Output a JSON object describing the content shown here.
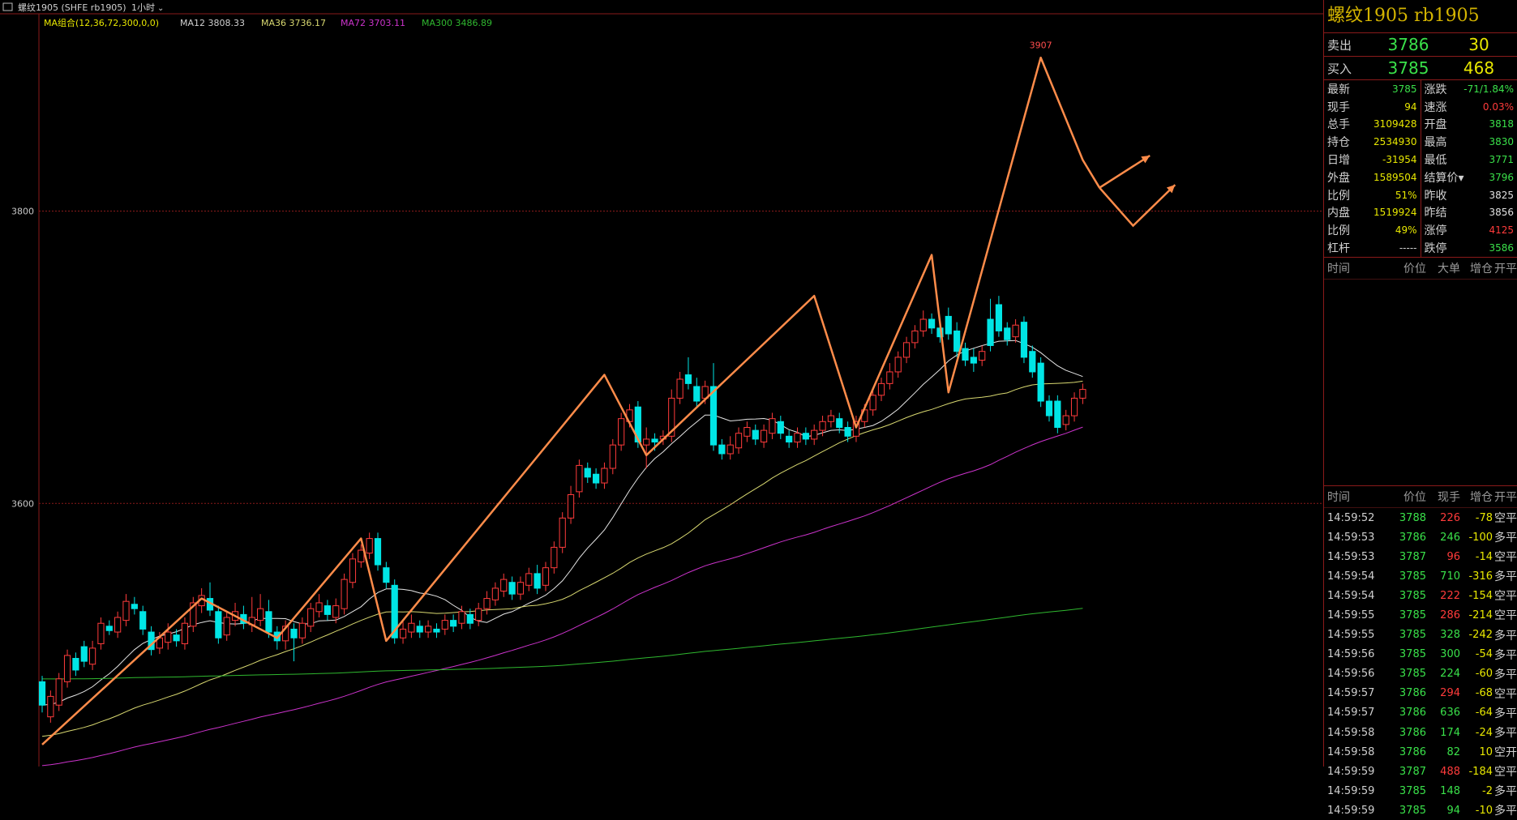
{
  "colors": {
    "up": "#ff3b3b",
    "down": "#00e5e5",
    "flat": "#d0d0d0",
    "green": "#3ae14a",
    "yellow": "#e8e800",
    "grid": "#8a1a1a",
    "ma12": "#e6e6e6",
    "ma36": "#d8d870",
    "ma72": "#cc33cc",
    "ma300": "#2fb82f",
    "pattern": "#ff8c4a"
  },
  "header": {
    "symbol": "螺纹1905 (SHFE rb1905)",
    "period": "1小时",
    "ma_group": "MA组合(12,36,72,300,0,0)",
    "ma12": "MA12 3808.33",
    "ma36": "MA36 3736.17",
    "ma72": "MA72 3703.11",
    "ma300": "MA300 3486.89"
  },
  "chart_data": {
    "type": "candlestick",
    "ylim": [
      3420,
      3935
    ],
    "yticks": [
      3600,
      3800
    ],
    "peak_label": "3907",
    "pattern_points": [
      [
        0,
        3435
      ],
      [
        19,
        3535
      ],
      [
        28,
        3508
      ],
      [
        38,
        3576
      ],
      [
        41,
        3506
      ],
      [
        67,
        3688
      ],
      [
        72,
        3633
      ],
      [
        92,
        3742
      ],
      [
        97,
        3652
      ],
      [
        106,
        3770
      ],
      [
        108,
        3676
      ],
      [
        119,
        3905
      ],
      [
        124,
        3835
      ],
      [
        126,
        3816
      ]
    ],
    "projection_arrows": [
      [
        [
          126,
          3816
        ],
        [
          132,
          3838
        ]
      ],
      [
        [
          126,
          3816
        ],
        [
          130,
          3790
        ],
        [
          135,
          3818
        ]
      ]
    ],
    "candles": [
      {
        "o": 3478,
        "c": 3462,
        "h": 3482,
        "l": 3457
      },
      {
        "o": 3454,
        "c": 3468,
        "h": 3472,
        "l": 3450
      },
      {
        "o": 3462,
        "c": 3480,
        "h": 3484,
        "l": 3458
      },
      {
        "o": 3478,
        "c": 3496,
        "h": 3500,
        "l": 3474
      },
      {
        "o": 3494,
        "c": 3486,
        "h": 3498,
        "l": 3482
      },
      {
        "o": 3502,
        "c": 3492,
        "h": 3506,
        "l": 3488
      },
      {
        "o": 3490,
        "c": 3501,
        "h": 3506,
        "l": 3486
      },
      {
        "o": 3504,
        "c": 3518,
        "h": 3522,
        "l": 3500
      },
      {
        "o": 3516,
        "c": 3513,
        "h": 3520,
        "l": 3510
      },
      {
        "o": 3512,
        "c": 3522,
        "h": 3526,
        "l": 3508
      },
      {
        "o": 3520,
        "c": 3533,
        "h": 3538,
        "l": 3516
      },
      {
        "o": 3531,
        "c": 3528,
        "h": 3536,
        "l": 3524
      },
      {
        "o": 3526,
        "c": 3514,
        "h": 3530,
        "l": 3510
      },
      {
        "o": 3512,
        "c": 3500,
        "h": 3516,
        "l": 3496
      },
      {
        "o": 3501,
        "c": 3508,
        "h": 3512,
        "l": 3497
      },
      {
        "o": 3505,
        "c": 3512,
        "h": 3518,
        "l": 3500
      },
      {
        "o": 3510,
        "c": 3506,
        "h": 3514,
        "l": 3502
      },
      {
        "o": 3504,
        "c": 3518,
        "h": 3522,
        "l": 3500
      },
      {
        "o": 3516,
        "c": 3532,
        "h": 3536,
        "l": 3512
      },
      {
        "o": 3530,
        "c": 3537,
        "h": 3542,
        "l": 3525
      },
      {
        "o": 3535,
        "c": 3527,
        "h": 3546,
        "l": 3523
      },
      {
        "o": 3526,
        "c": 3508,
        "h": 3530,
        "l": 3504
      },
      {
        "o": 3510,
        "c": 3522,
        "h": 3526,
        "l": 3506
      },
      {
        "o": 3520,
        "c": 3526,
        "h": 3532,
        "l": 3516
      },
      {
        "o": 3524,
        "c": 3518,
        "h": 3530,
        "l": 3514
      },
      {
        "o": 3517,
        "c": 3522,
        "h": 3536,
        "l": 3512
      },
      {
        "o": 3520,
        "c": 3528,
        "h": 3538,
        "l": 3516
      },
      {
        "o": 3526,
        "c": 3512,
        "h": 3534,
        "l": 3508
      },
      {
        "o": 3512,
        "c": 3506,
        "h": 3516,
        "l": 3500
      },
      {
        "o": 3506,
        "c": 3516,
        "h": 3520,
        "l": 3500
      },
      {
        "o": 3514,
        "c": 3508,
        "h": 3518,
        "l": 3492
      },
      {
        "o": 3508,
        "c": 3518,
        "h": 3522,
        "l": 3504
      },
      {
        "o": 3516,
        "c": 3528,
        "h": 3532,
        "l": 3512
      },
      {
        "o": 3526,
        "c": 3532,
        "h": 3538,
        "l": 3522
      },
      {
        "o": 3530,
        "c": 3524,
        "h": 3534,
        "l": 3520
      },
      {
        "o": 3522,
        "c": 3530,
        "h": 3535,
        "l": 3518
      },
      {
        "o": 3528,
        "c": 3548,
        "h": 3552,
        "l": 3524
      },
      {
        "o": 3546,
        "c": 3562,
        "h": 3566,
        "l": 3542
      },
      {
        "o": 3560,
        "c": 3568,
        "h": 3572,
        "l": 3556
      },
      {
        "o": 3566,
        "c": 3576,
        "h": 3580,
        "l": 3562
      },
      {
        "o": 3576,
        "c": 3558,
        "h": 3580,
        "l": 3554
      },
      {
        "o": 3556,
        "c": 3546,
        "h": 3560,
        "l": 3542
      },
      {
        "o": 3544,
        "c": 3508,
        "h": 3548,
        "l": 3504
      },
      {
        "o": 3508,
        "c": 3514,
        "h": 3520,
        "l": 3504
      },
      {
        "o": 3512,
        "c": 3518,
        "h": 3524,
        "l": 3508
      },
      {
        "o": 3516,
        "c": 3512,
        "h": 3520,
        "l": 3508
      },
      {
        "o": 3512,
        "c": 3516,
        "h": 3520,
        "l": 3508
      },
      {
        "o": 3514,
        "c": 3512,
        "h": 3518,
        "l": 3508
      },
      {
        "o": 3514,
        "c": 3520,
        "h": 3524,
        "l": 3510
      },
      {
        "o": 3520,
        "c": 3516,
        "h": 3524,
        "l": 3512
      },
      {
        "o": 3518,
        "c": 3526,
        "h": 3530,
        "l": 3514
      },
      {
        "o": 3524,
        "c": 3518,
        "h": 3528,
        "l": 3514
      },
      {
        "o": 3520,
        "c": 3528,
        "h": 3532,
        "l": 3516
      },
      {
        "o": 3528,
        "c": 3535,
        "h": 3540,
        "l": 3524
      },
      {
        "o": 3534,
        "c": 3542,
        "h": 3546,
        "l": 3530
      },
      {
        "o": 3540,
        "c": 3548,
        "h": 3552,
        "l": 3536
      },
      {
        "o": 3546,
        "c": 3538,
        "h": 3550,
        "l": 3534
      },
      {
        "o": 3538,
        "c": 3546,
        "h": 3550,
        "l": 3534
      },
      {
        "o": 3544,
        "c": 3552,
        "h": 3556,
        "l": 3540
      },
      {
        "o": 3552,
        "c": 3542,
        "h": 3558,
        "l": 3538
      },
      {
        "o": 3544,
        "c": 3556,
        "h": 3560,
        "l": 3540
      },
      {
        "o": 3556,
        "c": 3570,
        "h": 3574,
        "l": 3552
      },
      {
        "o": 3570,
        "c": 3590,
        "h": 3594,
        "l": 3566
      },
      {
        "o": 3590,
        "c": 3606,
        "h": 3612,
        "l": 3586
      },
      {
        "o": 3608,
        "c": 3626,
        "h": 3630,
        "l": 3604
      },
      {
        "o": 3624,
        "c": 3618,
        "h": 3628,
        "l": 3614
      },
      {
        "o": 3620,
        "c": 3614,
        "h": 3624,
        "l": 3610
      },
      {
        "o": 3614,
        "c": 3624,
        "h": 3628,
        "l": 3610
      },
      {
        "o": 3624,
        "c": 3640,
        "h": 3644,
        "l": 3620
      },
      {
        "o": 3640,
        "c": 3658,
        "h": 3662,
        "l": 3636
      },
      {
        "o": 3656,
        "c": 3664,
        "h": 3668,
        "l": 3652
      },
      {
        "o": 3666,
        "c": 3642,
        "h": 3670,
        "l": 3638
      },
      {
        "o": 3640,
        "c": 3644,
        "h": 3652,
        "l": 3624
      },
      {
        "o": 3644,
        "c": 3642,
        "h": 3648,
        "l": 3636
      },
      {
        "o": 3644,
        "c": 3646,
        "h": 3650,
        "l": 3640
      },
      {
        "o": 3646,
        "c": 3672,
        "h": 3678,
        "l": 3642
      },
      {
        "o": 3672,
        "c": 3685,
        "h": 3690,
        "l": 3668
      },
      {
        "o": 3688,
        "c": 3682,
        "h": 3700,
        "l": 3678
      },
      {
        "o": 3680,
        "c": 3670,
        "h": 3686,
        "l": 3666
      },
      {
        "o": 3672,
        "c": 3680,
        "h": 3684,
        "l": 3668
      },
      {
        "o": 3680,
        "c": 3640,
        "h": 3696,
        "l": 3636
      },
      {
        "o": 3640,
        "c": 3634,
        "h": 3644,
        "l": 3630
      },
      {
        "o": 3634,
        "c": 3640,
        "h": 3646,
        "l": 3630
      },
      {
        "o": 3638,
        "c": 3648,
        "h": 3652,
        "l": 3634
      },
      {
        "o": 3646,
        "c": 3652,
        "h": 3656,
        "l": 3642
      },
      {
        "o": 3650,
        "c": 3644,
        "h": 3654,
        "l": 3640
      },
      {
        "o": 3642,
        "c": 3650,
        "h": 3654,
        "l": 3638
      },
      {
        "o": 3648,
        "c": 3658,
        "h": 3662,
        "l": 3644
      },
      {
        "o": 3656,
        "c": 3648,
        "h": 3660,
        "l": 3644
      },
      {
        "o": 3646,
        "c": 3642,
        "h": 3650,
        "l": 3638
      },
      {
        "o": 3642,
        "c": 3648,
        "h": 3652,
        "l": 3638
      },
      {
        "o": 3648,
        "c": 3644,
        "h": 3652,
        "l": 3640
      },
      {
        "o": 3644,
        "c": 3650,
        "h": 3654,
        "l": 3640
      },
      {
        "o": 3650,
        "c": 3656,
        "h": 3660,
        "l": 3646
      },
      {
        "o": 3656,
        "c": 3660,
        "h": 3664,
        "l": 3652
      },
      {
        "o": 3658,
        "c": 3652,
        "h": 3662,
        "l": 3648
      },
      {
        "o": 3652,
        "c": 3646,
        "h": 3656,
        "l": 3642
      },
      {
        "o": 3646,
        "c": 3656,
        "h": 3660,
        "l": 3642
      },
      {
        "o": 3656,
        "c": 3664,
        "h": 3668,
        "l": 3652
      },
      {
        "o": 3664,
        "c": 3674,
        "h": 3678,
        "l": 3660
      },
      {
        "o": 3674,
        "c": 3682,
        "h": 3686,
        "l": 3670
      },
      {
        "o": 3682,
        "c": 3690,
        "h": 3696,
        "l": 3678
      },
      {
        "o": 3690,
        "c": 3700,
        "h": 3704,
        "l": 3686
      },
      {
        "o": 3700,
        "c": 3710,
        "h": 3714,
        "l": 3696
      },
      {
        "o": 3710,
        "c": 3718,
        "h": 3722,
        "l": 3706
      },
      {
        "o": 3718,
        "c": 3726,
        "h": 3732,
        "l": 3714
      },
      {
        "o": 3726,
        "c": 3720,
        "h": 3730,
        "l": 3716
      },
      {
        "o": 3720,
        "c": 3714,
        "h": 3724,
        "l": 3710
      },
      {
        "o": 3728,
        "c": 3716,
        "h": 3734,
        "l": 3712
      },
      {
        "o": 3718,
        "c": 3704,
        "h": 3724,
        "l": 3700
      },
      {
        "o": 3706,
        "c": 3698,
        "h": 3710,
        "l": 3694
      },
      {
        "o": 3700,
        "c": 3696,
        "h": 3706,
        "l": 3690
      },
      {
        "o": 3698,
        "c": 3704,
        "h": 3708,
        "l": 3694
      },
      {
        "o": 3726,
        "c": 3708,
        "h": 3740,
        "l": 3704
      },
      {
        "o": 3736,
        "c": 3718,
        "h": 3742,
        "l": 3714
      },
      {
        "o": 3720,
        "c": 3712,
        "h": 3724,
        "l": 3708
      },
      {
        "o": 3714,
        "c": 3722,
        "h": 3726,
        "l": 3710
      },
      {
        "o": 3724,
        "c": 3700,
        "h": 3728,
        "l": 3696
      },
      {
        "o": 3704,
        "c": 3690,
        "h": 3708,
        "l": 3686
      },
      {
        "o": 3696,
        "c": 3670,
        "h": 3700,
        "l": 3666
      },
      {
        "o": 3670,
        "c": 3660,
        "h": 3674,
        "l": 3656
      },
      {
        "o": 3670,
        "c": 3652,
        "h": 3674,
        "l": 3648
      },
      {
        "o": 3654,
        "c": 3660,
        "h": 3664,
        "l": 3650
      },
      {
        "o": 3660,
        "c": 3672,
        "h": 3676,
        "l": 3656
      },
      {
        "o": 3672,
        "c": 3678,
        "h": 3682,
        "l": 3668
      }
    ]
  },
  "panel": {
    "title": "螺纹1905  rb1905",
    "sell_label": "卖出",
    "sell_price": "3786",
    "sell_vol": "30",
    "buy_label": "买入",
    "buy_price": "3785",
    "buy_vol": "468",
    "left_stats": [
      {
        "k": "最新",
        "v": "3785",
        "c": "#3ae14a"
      },
      {
        "k": "现手",
        "v": "94",
        "c": "#e8e800"
      },
      {
        "k": "总手",
        "v": "3109428",
        "c": "#e8e800"
      },
      {
        "k": "持仓",
        "v": "2534930",
        "c": "#e8e800"
      },
      {
        "k": "日增",
        "v": "-31954",
        "c": "#e8e800"
      },
      {
        "k": "外盘",
        "v": "1589504",
        "c": "#e8e800"
      },
      {
        "k": "比例",
        "v": "51%",
        "c": "#e8e800"
      },
      {
        "k": "内盘",
        "v": "1519924",
        "c": "#e8e800"
      },
      {
        "k": "比例",
        "v": "49%",
        "c": "#e8e800"
      },
      {
        "k": "杠杆",
        "v": "-----",
        "c": "#d0d0d0"
      }
    ],
    "right_stats": [
      {
        "k": "涨跌",
        "v": "-71/1.84%",
        "c": "#3ae14a"
      },
      {
        "k": "速涨",
        "v": "0.03%",
        "c": "#ff3b3b"
      },
      {
        "k": "开盘",
        "v": "3818",
        "c": "#3ae14a"
      },
      {
        "k": "最高",
        "v": "3830",
        "c": "#3ae14a"
      },
      {
        "k": "最低",
        "v": "3771",
        "c": "#3ae14a"
      },
      {
        "k": "结算价▾",
        "v": "3796",
        "c": "#3ae14a"
      },
      {
        "k": "昨收",
        "v": "3825",
        "c": "#e0e0e0"
      },
      {
        "k": "昨结",
        "v": "3856",
        "c": "#e0e0e0"
      },
      {
        "k": "涨停",
        "v": "4125",
        "c": "#ff3b3b"
      },
      {
        "k": "跌停",
        "v": "3586",
        "c": "#3ae14a"
      }
    ],
    "big_header": {
      "time": "时间",
      "price": "价位",
      "vol": "大单",
      "oi": "增仓",
      "type": "开平"
    },
    "tick_header": {
      "time": "时间",
      "price": "价位",
      "vol": "现手",
      "oi": "增仓",
      "type": "开平"
    },
    "ticks": [
      {
        "time": "14:59:52",
        "price": "3788",
        "vol": "226",
        "vc": "#ff3b3b",
        "oi": "-78",
        "type": "空平"
      },
      {
        "time": "14:59:53",
        "price": "3786",
        "vol": "246",
        "vc": "#3ae14a",
        "oi": "-100",
        "type": "多平"
      },
      {
        "time": "14:59:53",
        "price": "3787",
        "vol": "96",
        "vc": "#ff3b3b",
        "oi": "-14",
        "type": "空平"
      },
      {
        "time": "14:59:54",
        "price": "3785",
        "vol": "710",
        "vc": "#3ae14a",
        "oi": "-316",
        "type": "多平"
      },
      {
        "time": "14:59:54",
        "price": "3785",
        "vol": "222",
        "vc": "#ff3b3b",
        "oi": "-154",
        "type": "空平"
      },
      {
        "time": "14:59:55",
        "price": "3785",
        "vol": "286",
        "vc": "#ff3b3b",
        "oi": "-214",
        "type": "空平"
      },
      {
        "time": "14:59:55",
        "price": "3785",
        "vol": "328",
        "vc": "#3ae14a",
        "oi": "-242",
        "type": "多平"
      },
      {
        "time": "14:59:56",
        "price": "3785",
        "vol": "300",
        "vc": "#3ae14a",
        "oi": "-54",
        "type": "多平"
      },
      {
        "time": "14:59:56",
        "price": "3785",
        "vol": "224",
        "vc": "#3ae14a",
        "oi": "-60",
        "type": "多平"
      },
      {
        "time": "14:59:57",
        "price": "3786",
        "vol": "294",
        "vc": "#ff3b3b",
        "oi": "-68",
        "type": "空平"
      },
      {
        "time": "14:59:57",
        "price": "3786",
        "vol": "636",
        "vc": "#3ae14a",
        "oi": "-64",
        "type": "多平"
      },
      {
        "time": "14:59:58",
        "price": "3786",
        "vol": "174",
        "vc": "#3ae14a",
        "oi": "-24",
        "type": "多平"
      },
      {
        "time": "14:59:58",
        "price": "3786",
        "vol": "82",
        "vc": "#3ae14a",
        "oi": "10",
        "type": "空开"
      },
      {
        "time": "14:59:59",
        "price": "3787",
        "vol": "488",
        "vc": "#ff3b3b",
        "oi": "-184",
        "type": "空平"
      },
      {
        "time": "14:59:59",
        "price": "3785",
        "vol": "148",
        "vc": "#3ae14a",
        "oi": "-2",
        "type": "多平"
      },
      {
        "time": "14:59:59",
        "price": "3785",
        "vol": "94",
        "vc": "#3ae14a",
        "oi": "-10",
        "type": "多平"
      }
    ]
  }
}
